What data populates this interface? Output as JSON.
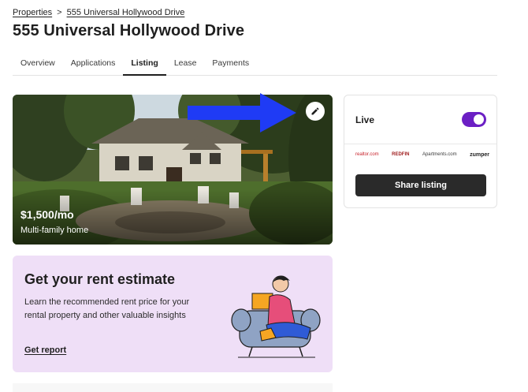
{
  "breadcrumb": {
    "parent": "Properties",
    "separator": ">",
    "current": "555 Universal Hollywood Drive"
  },
  "page": {
    "title": "555 Universal Hollywood Drive"
  },
  "tabs": [
    {
      "label": "Overview",
      "active": false
    },
    {
      "label": "Applications",
      "active": false
    },
    {
      "label": "Listing",
      "active": true
    },
    {
      "label": "Lease",
      "active": false
    },
    {
      "label": "Payments",
      "active": false
    }
  ],
  "listing": {
    "price": "$1,500/mo",
    "home_type": "Multi-family home",
    "edit_icon": "pencil-icon",
    "annotation_arrow_color": "#1f3bf5"
  },
  "live_card": {
    "label": "Live",
    "toggle_on": true,
    "toggle_color": "#6b1fc4",
    "partners": [
      "realtor.com",
      "REDFIN",
      "Apartments.com",
      "zumper"
    ],
    "share_label": "Share listing"
  },
  "estimate": {
    "title": "Get your rent estimate",
    "description": "Learn the recommended rent price for your rental property and other valuable insights",
    "link_label": "Get report",
    "background": "#efdff7"
  }
}
